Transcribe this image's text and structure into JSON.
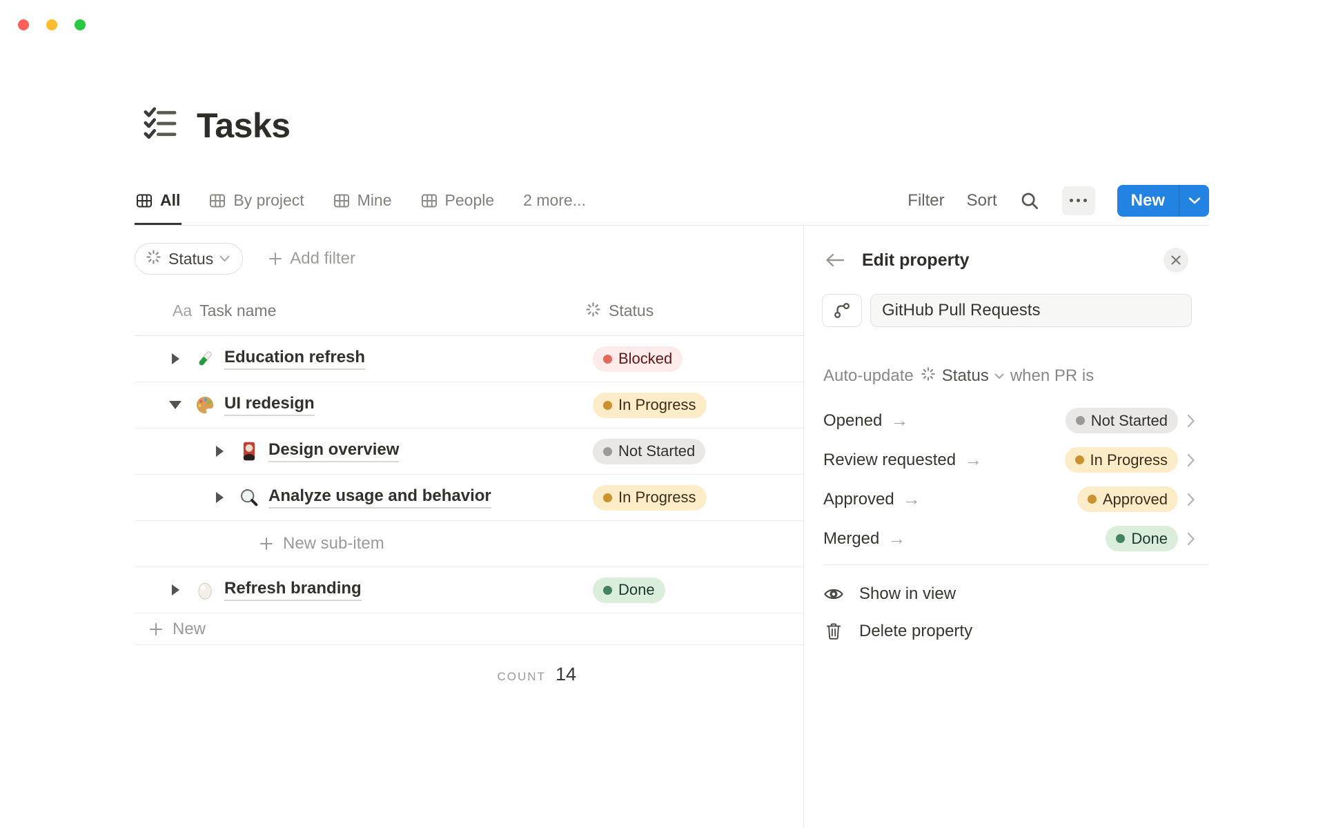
{
  "traffic_lights": {
    "close": "#ff5f57",
    "minimize": "#febc2e",
    "zoom": "#28c840"
  },
  "page": {
    "title": "Tasks"
  },
  "tabs": {
    "items": [
      {
        "label": "All",
        "active": true,
        "icon": "table"
      },
      {
        "label": "By project",
        "active": false,
        "icon": "table"
      },
      {
        "label": "Mine",
        "active": false,
        "icon": "table"
      },
      {
        "label": "People",
        "active": false,
        "icon": "table"
      },
      {
        "label": "2 more...",
        "active": false,
        "icon": "none"
      }
    ]
  },
  "toolbar": {
    "filter": "Filter",
    "sort": "Sort",
    "new": "New",
    "more_icon": "ellipsis",
    "search_icon": "magnifier"
  },
  "filter_bar": {
    "status": "Status",
    "add_filter": "Add filter"
  },
  "table": {
    "header": {
      "name_prefix": "Aa",
      "name": "Task name",
      "status": "Status",
      "status_icon": "status-spinner"
    },
    "rows": [
      {
        "name": "Education refresh",
        "icon": "test-tube",
        "level": 0,
        "toggle": "collapsed",
        "status": "Blocked",
        "status_color": "red"
      },
      {
        "name": "UI redesign",
        "icon": "palette",
        "level": 0,
        "toggle": "expanded",
        "status": "In Progress",
        "status_color": "yellow"
      },
      {
        "name": "Design overview",
        "icon": "flower-card",
        "level": 1,
        "toggle": "collapsed",
        "status": "Not Started",
        "status_color": "gray"
      },
      {
        "name": "Analyze usage and behavior",
        "icon": "magnifier",
        "level": 1,
        "toggle": "collapsed",
        "status": "In Progress",
        "status_color": "yellow"
      },
      {
        "name": "Refresh branding",
        "icon": "egg",
        "level": 0,
        "toggle": "collapsed",
        "status": "Done",
        "status_color": "green"
      }
    ],
    "new_sub_item": "New sub-item",
    "new_row": "New",
    "count_label": "COUNT",
    "count_value": "14"
  },
  "panel": {
    "title": "Edit property",
    "property_name": "GitHub Pull Requests",
    "property_icon": "git-branch",
    "auto_update_prefix": "Auto-update",
    "auto_update_property": "Status",
    "auto_update_suffix": "when PR is",
    "mappings": [
      {
        "event": "Opened",
        "status": "Not Started",
        "status_color": "gray"
      },
      {
        "event": "Review requested",
        "status": "In Progress",
        "status_color": "yellow"
      },
      {
        "event": "Approved",
        "status": "Approved",
        "status_color": "yellow"
      },
      {
        "event": "Merged",
        "status": "Done",
        "status_color": "green"
      }
    ],
    "actions": {
      "show_in_view": "Show in view",
      "delete_property": "Delete property"
    }
  },
  "colors": {
    "accent_blue": "#2383e2",
    "status_red_bg": "#fdebec",
    "status_red_dot": "#e16a5e",
    "status_red_text": "#5d1715",
    "status_yellow_bg": "#fdecc8",
    "status_yellow_dot": "#cb912f",
    "status_yellow_text": "#402c1b",
    "status_gray_bg": "#e9e8e6",
    "status_gray_dot": "#9b9a97",
    "status_gray_text": "#32302c",
    "status_green_bg": "#dbeddb",
    "status_green_dot": "#448361",
    "status_green_text": "#1c3829"
  }
}
